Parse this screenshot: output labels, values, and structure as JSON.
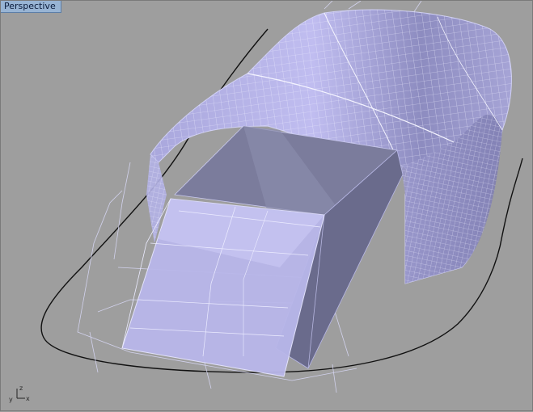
{
  "viewport": {
    "title": "Perspective"
  },
  "axes": {
    "x": "x",
    "y": "y",
    "z": "z"
  },
  "colors": {
    "background": "#9e9e9e",
    "surface_fill": "#b8b6e8",
    "surface_wire": "#ececff",
    "box_dark": "#6e6f8e",
    "box_mid": "#8586a8",
    "curve": "#111111"
  }
}
